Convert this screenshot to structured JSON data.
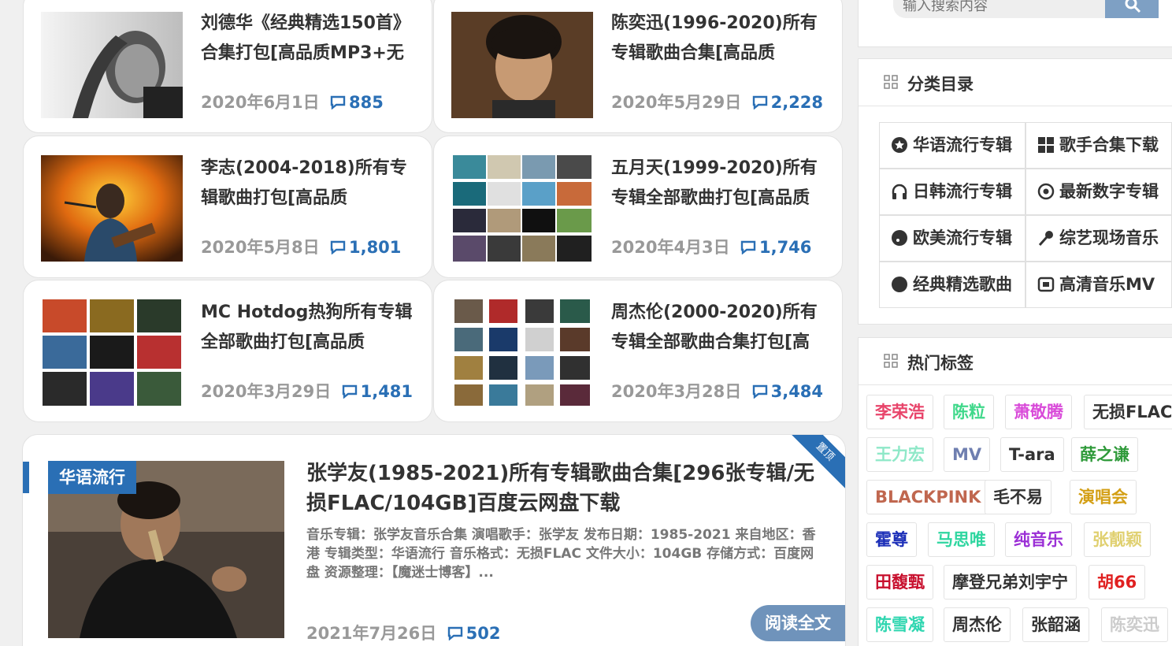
{
  "cards": [
    {
      "title": "刘德华《经典精选150首》合集打包[高品质MP3+无",
      "date": "2020年6月1日",
      "comments": "885"
    },
    {
      "title": "陈奕迅(1996-2020)所有专辑歌曲合集[高品质",
      "date": "2020年5月29日",
      "comments": "2,228"
    },
    {
      "title": "李志(2004-2018)所有专辑歌曲打包[高品质",
      "date": "2020年5月8日",
      "comments": "1,801"
    },
    {
      "title": "五月天(1999-2020)所有专辑全部歌曲打包[高品质",
      "date": "2020年4月3日",
      "comments": "1,746"
    },
    {
      "title": "MC Hotdog热狗所有专辑全部歌曲打包[高品质",
      "date": "2020年3月29日",
      "comments": "1,481"
    },
    {
      "title": "周杰伦(2000-2020)所有专辑全部歌曲合集打包[高",
      "date": "2020年3月28日",
      "comments": "3,484"
    }
  ],
  "feature": {
    "category": "华语流行",
    "corner": "置顶",
    "title": "张学友(1985-2021)所有专辑歌曲合集[296张专辑/无损FLAC/104GB]百度云网盘下载",
    "desc": "音乐专辑：张学友音乐合集 演唱歌手：张学友 发布日期：1985-2021 来自地区：香港 专辑类型：华语流行 音乐格式：无损FLAC 文件大小：104GB 存储方式：百度网盘 资源整理：【魔迷士博客】...",
    "date": "2021年7月26日",
    "comments": "502",
    "readmore": "阅读全文"
  },
  "search": {
    "placeholder": "输入搜索内容"
  },
  "categories": {
    "title": "分类目录",
    "items": [
      {
        "label": "华语流行专辑",
        "icon": "star-circle-icon"
      },
      {
        "label": "歌手合集下载",
        "icon": "grid-icon"
      },
      {
        "label": "日韩流行专辑",
        "icon": "headphones-icon"
      },
      {
        "label": "最新数字专辑",
        "icon": "disc-icon"
      },
      {
        "label": "欧美流行专辑",
        "icon": "circle-music-icon"
      },
      {
        "label": "综艺现场音乐",
        "icon": "microphone-icon"
      },
      {
        "label": "经典精选歌曲",
        "icon": "record-icon"
      },
      {
        "label": "高清音乐MV",
        "icon": "video-icon"
      }
    ]
  },
  "tags": {
    "title": "热门标签",
    "items": [
      {
        "label": "李荣浩",
        "color": "#e8446a"
      },
      {
        "label": "陈粒",
        "color": "#3fd88a"
      },
      {
        "label": "萧敬腾",
        "color": "#d94bd9"
      },
      {
        "label": "无损FLAC",
        "color": "#333333"
      },
      {
        "label": "王力宏",
        "color": "#8fe8c8"
      },
      {
        "label": "MV",
        "color": "#6f7fb0"
      },
      {
        "label": "T-ara",
        "color": "#333333"
      },
      {
        "label": "薛之谦",
        "color": "#2f9a3a"
      },
      {
        "label": "BLACKPINK",
        "color": "#c0674f"
      },
      {
        "label": "毛不易",
        "color": "#333333"
      },
      {
        "label": "演唱会",
        "color": "#d4a017"
      },
      {
        "label": "霍尊",
        "color": "#1c2fb8"
      },
      {
        "label": "马思唯",
        "color": "#2fd6a0"
      },
      {
        "label": "纯音乐",
        "color": "#9b2fd6"
      },
      {
        "label": "张靓颖",
        "color": "#e0d070"
      },
      {
        "label": "田馥甄",
        "color": "#c8102e"
      },
      {
        "label": "摩登兄弟刘宇宁",
        "color": "#333333"
      },
      {
        "label": "胡66",
        "color": "#e02020"
      },
      {
        "label": "陈雪凝",
        "color": "#2fd6b0"
      },
      {
        "label": "周杰伦",
        "color": "#333333"
      },
      {
        "label": "张韶涵",
        "color": "#333333"
      },
      {
        "label": "陈奕迅",
        "color": "#cccccc"
      }
    ]
  }
}
